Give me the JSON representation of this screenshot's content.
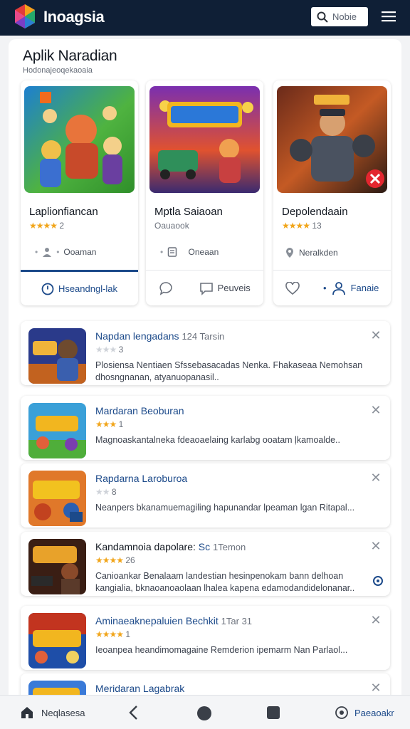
{
  "header": {
    "app_title": "Inoagsia",
    "search_label": "Nobie",
    "menu_icon": "hamburger-icon",
    "logo_icon": "colorful-gem-logo"
  },
  "page": {
    "title": "Aplik Naradian",
    "subtitle": "Hodonajeoqekaoaia"
  },
  "featured": [
    {
      "name": "Laplionfiancan",
      "stars": 4,
      "rating_text": "2",
      "meta_label": "Ooaman",
      "action_primary": "Hseandngl-lak",
      "accent": "#1c4a8a",
      "icon": "person-icon"
    },
    {
      "name": "Mptla Saiaoan",
      "rating_text": "Oauaook",
      "meta_label": "Oneaan",
      "action_secondary": "Peuveis",
      "icon": "document-icon"
    },
    {
      "name": "Depolendaain",
      "stars": 4,
      "rating_text": "13",
      "meta_label": "Neralkden",
      "action_secondary": "Fanaie",
      "icon": "location-icon"
    }
  ],
  "list": [
    {
      "title": "Napdan lengadans",
      "meta": "124 Tarsin",
      "stars": 2,
      "rating_text": "3",
      "description": "Plosiensa Nentiaen Sfssebasacadas Nenka. Fhakaseaa Nemohsan dhosngnanan, atyanuopanasil.."
    },
    {
      "title": "Mardaran Beoburan",
      "stars": 3,
      "rating_text": "1",
      "description": "Magnoaskantalneka fdeaoaelaing karlabg ooatam ļkamoalde.."
    },
    {
      "title": "Rapdarna Laroburoa",
      "stars": 0,
      "rating_text": "8",
      "description": "Neanpers bkanamuemagiling hapunandar lpeaman lgan Ritapal..."
    },
    {
      "title": "Kandamnoia dapolare:",
      "meta_accent": "Sc",
      "meta": "1Temon",
      "stars": 4,
      "rating_text": "26",
      "description": "Canioankar Benalaam landestian hesinpenokam bann delhoan kangialia, bknaoanoaolaan lhalea kapena edamodandidelonanar.."
    },
    {
      "title": "Aminaeaknepaluien Bechkit",
      "meta": "1Tar 31",
      "stars": 4,
      "rating_text": "1",
      "description": "Ieoanpea heandimomagaine Remderion ipemarm Nan Parlaol..."
    },
    {
      "title": "Meridaran Lagabrak",
      "stars": 0,
      "rating_text": ""
    }
  ],
  "bottom_nav": {
    "home_label": "Neqlasesa",
    "right_label": "Paeaoakr"
  },
  "colors": {
    "header_bg": "#0f1f36",
    "accent": "#1c4a8a",
    "star": "#f1a51a"
  }
}
